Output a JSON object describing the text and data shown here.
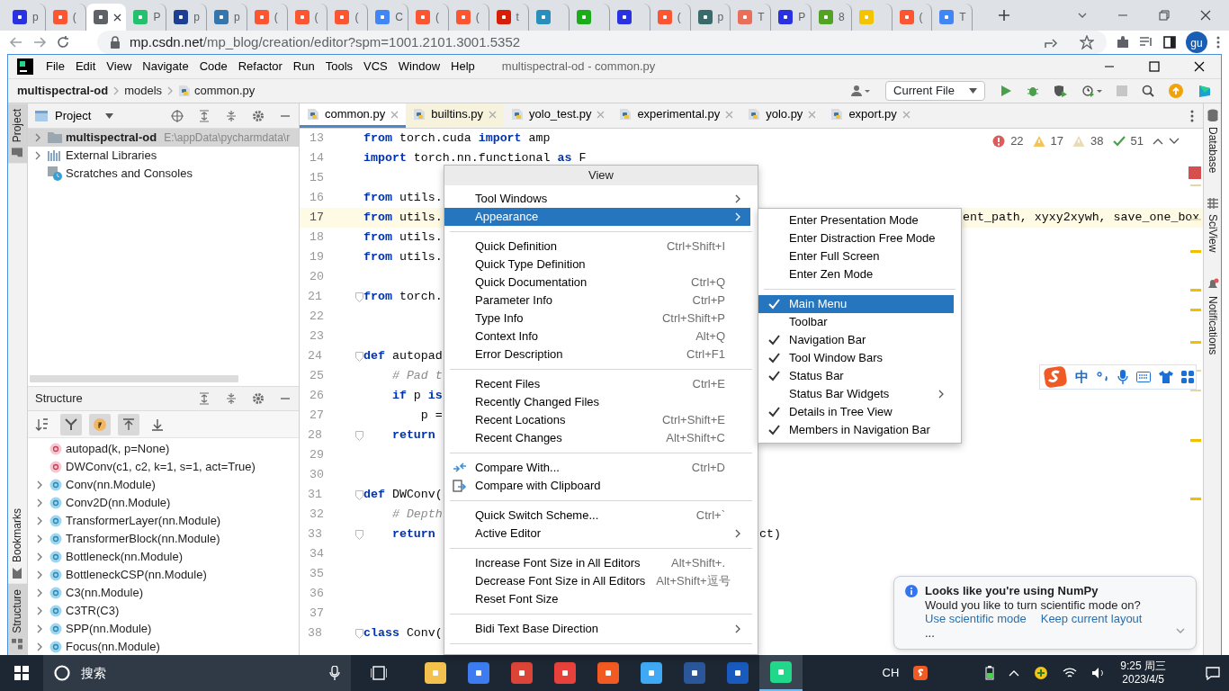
{
  "browser": {
    "tabs": [
      {
        "title": "p",
        "color": "#2932e1",
        "selected": false
      },
      {
        "title": "(",
        "color": "#fc5531",
        "selected": false
      },
      {
        "color": "#5f6368",
        "selected": true
      },
      {
        "title": "P",
        "color": "#23c16b",
        "selected": false
      },
      {
        "title": "p",
        "color": "#1c3f94",
        "selected": false
      },
      {
        "title": "p",
        "color": "#3776ab",
        "selected": false
      },
      {
        "title": "(",
        "color": "#fc5531",
        "selected": false
      },
      {
        "title": "(",
        "color": "#fc5531",
        "selected": false
      },
      {
        "title": "(",
        "color": "#fc5531",
        "selected": false
      },
      {
        "title": "C",
        "color": "#4285f4",
        "selected": false
      },
      {
        "title": "(",
        "color": "#fc5531",
        "selected": false
      },
      {
        "title": "(",
        "color": "#fc5531",
        "selected": false
      },
      {
        "title": "t",
        "color": "#d81e06",
        "selected": false
      },
      {
        "color": "#2a8fbd",
        "selected": false
      },
      {
        "color": "#1aad19",
        "selected": false
      },
      {
        "color": "#2932e1",
        "selected": false
      },
      {
        "title": "(",
        "color": "#fc5531",
        "selected": false
      },
      {
        "title": "p",
        "color": "#3a6b6b",
        "selected": false
      },
      {
        "title": "T",
        "color": "#ea6f5a",
        "selected": false
      },
      {
        "title": "P",
        "color": "#2932e1",
        "selected": false
      },
      {
        "title": "8",
        "color": "#52a224",
        "selected": false
      },
      {
        "color": "#f5c400",
        "selected": false
      },
      {
        "title": "(",
        "color": "#fc5531",
        "selected": false
      },
      {
        "title": "T",
        "color": "#4285f4",
        "selected": false
      }
    ],
    "url_host": "mp.csdn.net",
    "url_path": "/mp_blog/creation/editor?spm=1001.2101.3001.5352",
    "avatar": "gu"
  },
  "ide": {
    "menu": [
      "File",
      "Edit",
      "View",
      "Navigate",
      "Code",
      "Refactor",
      "Run",
      "Tools",
      "VCS",
      "Window",
      "Help"
    ],
    "title": "multispectral-od - common.py",
    "breadcrumb": [
      "multispectral-od",
      "models",
      "common.py"
    ],
    "run_config": "Current File",
    "left_stripe": [
      {
        "label": "Project",
        "selected": true
      },
      {
        "label": "Bookmarks",
        "selected": false
      },
      {
        "label": "Structure",
        "selected": true
      }
    ],
    "right_stripe": [
      "Database",
      "SciView",
      "Notifications"
    ],
    "project": {
      "title": "Project",
      "tree": [
        {
          "label": "multispectral-od",
          "path": "E:\\appData\\pycharmdata\\r",
          "kind": "folder",
          "expandable": true,
          "selected": true
        },
        {
          "label": "External Libraries",
          "kind": "library",
          "expandable": true,
          "selected": false
        },
        {
          "label": "Scratches and Consoles",
          "kind": "scratch",
          "expandable": false,
          "selected": false
        }
      ]
    },
    "structure": {
      "title": "Structure",
      "toolbar": [
        {
          "kind": "sort",
          "pressed": false
        },
        {
          "kind": "filter",
          "pressed": true
        },
        {
          "kind": "fields",
          "pressed": true
        },
        {
          "kind": "expand",
          "pressed": true
        },
        {
          "kind": "collapse",
          "pressed": false
        }
      ],
      "items": [
        {
          "label": "autopad(k, p=None)",
          "kind": "function",
          "expandable": false
        },
        {
          "label": "DWConv(c1, c2, k=1, s=1, act=True)",
          "kind": "function",
          "expandable": false
        },
        {
          "label": "Conv(nn.Module)",
          "kind": "class",
          "expandable": true
        },
        {
          "label": "Conv2D(nn.Module)",
          "kind": "class",
          "expandable": true
        },
        {
          "label": "TransformerLayer(nn.Module)",
          "kind": "class",
          "expandable": true
        },
        {
          "label": "TransformerBlock(nn.Module)",
          "kind": "class",
          "expandable": true
        },
        {
          "label": "Bottleneck(nn.Module)",
          "kind": "class",
          "expandable": true
        },
        {
          "label": "BottleneckCSP(nn.Module)",
          "kind": "class",
          "expandable": true
        },
        {
          "label": "C3(nn.Module)",
          "kind": "class",
          "expandable": true
        },
        {
          "label": "C3TR(C3)",
          "kind": "class",
          "expandable": true
        },
        {
          "label": "SPP(nn.Module)",
          "kind": "class",
          "expandable": true
        },
        {
          "label": "Focus(nn.Module)",
          "kind": "class",
          "expandable": true
        }
      ]
    },
    "tabs": [
      {
        "label": "common.py",
        "selected": true,
        "library": false
      },
      {
        "label": "builtins.py",
        "selected": false,
        "library": true
      },
      {
        "label": "yolo_test.py",
        "selected": false,
        "library": false
      },
      {
        "label": "experimental.py",
        "selected": false,
        "library": false
      },
      {
        "label": "yolo.py",
        "selected": false,
        "library": false
      },
      {
        "label": "export.py",
        "selected": false,
        "library": false
      }
    ],
    "inspections": [
      {
        "kind": "error",
        "count": "22"
      },
      {
        "kind": "warning",
        "count": "17"
      },
      {
        "kind": "weak",
        "count": "38"
      },
      {
        "kind": "typo",
        "count": "51"
      }
    ],
    "lines": [
      {
        "number": "13",
        "current": false,
        "fold": false,
        "tokens": [
          {
            "kind": "kw",
            "t": "from"
          },
          {
            "kind": "txt",
            "t": " torch.cuda "
          },
          {
            "kind": "kw",
            "t": "import"
          },
          {
            "kind": "txt",
            "t": " amp"
          }
        ]
      },
      {
        "number": "14",
        "current": false,
        "fold": false,
        "tokens": [
          {
            "kind": "kw",
            "t": "import"
          },
          {
            "kind": "txt",
            "t": " torch.nn.functional "
          },
          {
            "kind": "kw",
            "t": "as"
          },
          {
            "kind": "txt",
            "t": " F"
          }
        ]
      },
      {
        "number": "15",
        "current": false,
        "fold": false
      },
      {
        "number": "16",
        "current": false,
        "fold": false,
        "tokens": [
          {
            "kind": "kw",
            "t": "from"
          },
          {
            "kind": "txt",
            "t": " utils."
          }
        ]
      },
      {
        "number": "17",
        "current": true,
        "fold": false,
        "tokens": [
          {
            "kind": "kw",
            "t": "from"
          },
          {
            "kind": "txt",
            "t": " utils."
          }
        ],
        "tail": "ent_path, xyxy2xywh, save_one_box"
      },
      {
        "number": "18",
        "current": false,
        "fold": false,
        "tokens": [
          {
            "kind": "kw",
            "t": "from"
          },
          {
            "kind": "txt",
            "t": " utils."
          }
        ]
      },
      {
        "number": "19",
        "current": false,
        "fold": false,
        "tokens": [
          {
            "kind": "kw",
            "t": "from"
          },
          {
            "kind": "txt",
            "t": " utils."
          }
        ]
      },
      {
        "number": "20",
        "current": false,
        "fold": false
      },
      {
        "number": "21",
        "current": false,
        "fold": true,
        "tokens": [
          {
            "kind": "kw",
            "t": "from"
          },
          {
            "kind": "txt",
            "t": " torch."
          }
        ]
      },
      {
        "number": "22",
        "current": false,
        "fold": false
      },
      {
        "number": "23",
        "current": false,
        "fold": false
      },
      {
        "number": "24",
        "current": false,
        "fold": true,
        "tokens": [
          {
            "kind": "kw",
            "t": "def"
          },
          {
            "kind": "txt",
            "t": " autopad"
          }
        ]
      },
      {
        "number": "25",
        "current": false,
        "fold": false,
        "tokens": [
          {
            "kind": "cmt",
            "t": "    # Pad t"
          }
        ]
      },
      {
        "number": "26",
        "current": false,
        "fold": false,
        "tokens": [
          {
            "kind": "kw",
            "t": "    if"
          },
          {
            "kind": "txt",
            "t": " p "
          },
          {
            "kind": "kw",
            "t": "is"
          }
        ]
      },
      {
        "number": "27",
        "current": false,
        "fold": false,
        "tokens": [
          {
            "kind": "txt",
            "t": "        p ="
          }
        ]
      },
      {
        "number": "28",
        "current": false,
        "fold": true,
        "tokens": [
          {
            "kind": "kw",
            "t": "    return"
          }
        ]
      },
      {
        "number": "29",
        "current": false,
        "fold": false
      },
      {
        "number": "30",
        "current": false,
        "fold": false
      },
      {
        "number": "31",
        "current": false,
        "fold": true,
        "tokens": [
          {
            "kind": "kw",
            "t": "def"
          },
          {
            "kind": "txt",
            "t": " DWConv("
          }
        ]
      },
      {
        "number": "32",
        "current": false,
        "fold": false,
        "tokens": [
          {
            "kind": "cmt",
            "t": "    # Depth"
          }
        ]
      },
      {
        "number": "33",
        "current": false,
        "fold": true,
        "tokens": [
          {
            "kind": "kw",
            "t": "    return"
          }
        ],
        "tail": "ct)"
      },
      {
        "number": "34",
        "current": false,
        "fold": false
      },
      {
        "number": "35",
        "current": false,
        "fold": false
      },
      {
        "number": "36",
        "current": false,
        "fold": false
      },
      {
        "number": "37",
        "current": false,
        "fold": false
      },
      {
        "number": "38",
        "current": false,
        "fold": true,
        "tokens": [
          {
            "kind": "kw",
            "t": "class"
          },
          {
            "kind": "txt",
            "t": " Conv("
          }
        ]
      }
    ],
    "view_menu": {
      "title": "View",
      "items": [
        {
          "kind": "item",
          "label": "Tool Windows",
          "submenu": true,
          "selected": false
        },
        {
          "kind": "item",
          "label": "Appearance",
          "submenu": true,
          "selected": true
        },
        {
          "kind": "separator"
        },
        {
          "kind": "item",
          "label": "Quick Definition",
          "shortcut": "Ctrl+Shift+I",
          "submenu": false,
          "selected": false
        },
        {
          "kind": "item",
          "label": "Quick Type Definition",
          "submenu": false,
          "selected": false
        },
        {
          "kind": "item",
          "label": "Quick Documentation",
          "shortcut": "Ctrl+Q",
          "submenu": false,
          "selected": false
        },
        {
          "kind": "item",
          "label": "Parameter Info",
          "shortcut": "Ctrl+P",
          "submenu": false,
          "selected": false
        },
        {
          "kind": "item",
          "label": "Type Info",
          "shortcut": "Ctrl+Shift+P",
          "submenu": false,
          "selected": false
        },
        {
          "kind": "item",
          "label": "Context Info",
          "shortcut": "Alt+Q",
          "submenu": false,
          "selected": false
        },
        {
          "kind": "item",
          "label": "Error Description",
          "shortcut": "Ctrl+F1",
          "submenu": false,
          "selected": false
        },
        {
          "kind": "separator"
        },
        {
          "kind": "item",
          "label": "Recent Files",
          "shortcut": "Ctrl+E",
          "submenu": false,
          "selected": false
        },
        {
          "kind": "item",
          "label": "Recently Changed Files",
          "submenu": false,
          "selected": false
        },
        {
          "kind": "item",
          "label": "Recent Locations",
          "shortcut": "Ctrl+Shift+E",
          "submenu": false,
          "selected": false
        },
        {
          "kind": "item",
          "label": "Recent Changes",
          "shortcut": "Alt+Shift+C",
          "submenu": false,
          "selected": false
        },
        {
          "kind": "separator"
        },
        {
          "kind": "diff",
          "label": "Compare With...",
          "shortcut": "Ctrl+D",
          "submenu": false,
          "selected": false
        },
        {
          "kind": "clipboard",
          "label": "Compare with Clipboard",
          "submenu": false,
          "selected": false
        },
        {
          "kind": "separator"
        },
        {
          "kind": "item",
          "label": "Quick Switch Scheme...",
          "shortcut": "Ctrl+`",
          "submenu": false,
          "selected": false
        },
        {
          "kind": "item",
          "label": "Active Editor",
          "submenu": true,
          "selected": false
        },
        {
          "kind": "separator"
        },
        {
          "kind": "item",
          "label": "Increase Font Size in All Editors",
          "shortcut": "Alt+Shift+.",
          "submenu": false,
          "selected": false
        },
        {
          "kind": "item",
          "label": "Decrease Font Size in All Editors",
          "shortcut": "Alt+Shift+逗号",
          "submenu": false,
          "selected": false
        },
        {
          "kind": "item",
          "label": "Reset Font Size",
          "submenu": false,
          "selected": false
        },
        {
          "kind": "separator"
        },
        {
          "kind": "item",
          "label": "Bidi Text Base Direction",
          "submenu": true,
          "selected": false
        },
        {
          "kind": "separator"
        }
      ]
    },
    "appearance_menu": [
      {
        "kind": "item",
        "label": "Enter Presentation Mode",
        "checked": false,
        "submenu": false,
        "selected": false
      },
      {
        "kind": "item",
        "label": "Enter Distraction Free Mode",
        "checked": false,
        "submenu": false,
        "selected": false
      },
      {
        "kind": "item",
        "label": "Enter Full Screen",
        "checked": false,
        "submenu": false,
        "selected": false
      },
      {
        "kind": "item",
        "label": "Enter Zen Mode",
        "checked": false,
        "submenu": false,
        "selected": false
      },
      {
        "kind": "separator"
      },
      {
        "kind": "item",
        "label": "Main Menu",
        "checked": true,
        "submenu": false,
        "selected": true
      },
      {
        "kind": "item",
        "label": "Toolbar",
        "checked": false,
        "submenu": false,
        "selected": false
      },
      {
        "kind": "item",
        "label": "Navigation Bar",
        "checked": true,
        "submenu": false,
        "selected": false
      },
      {
        "kind": "item",
        "label": "Tool Window Bars",
        "checked": true,
        "submenu": false,
        "selected": false
      },
      {
        "kind": "item",
        "label": "Status Bar",
        "checked": true,
        "submenu": false,
        "selected": false
      },
      {
        "kind": "item",
        "label": "Status Bar Widgets",
        "checked": false,
        "submenu": true,
        "selected": false
      },
      {
        "kind": "item",
        "label": "Details in Tree View",
        "checked": true,
        "submenu": false,
        "selected": false
      },
      {
        "kind": "item",
        "label": "Members in Navigation Bar",
        "checked": true,
        "submenu": false,
        "selected": false
      }
    ],
    "notification": {
      "title": "Looks like you're using NumPy",
      "body": "Would you like to turn scientific mode on?",
      "actions": [
        "Use scientific mode",
        "Keep current layout"
      ],
      "more": "..."
    }
  },
  "ime": {
    "mode": "中"
  },
  "taskbar": {
    "search": "搜索",
    "apps": [
      {
        "color": "#f4c04e",
        "selected": false
      },
      {
        "color": "#3c7cf0",
        "selected": false
      },
      {
        "color": "#db4437",
        "selected": false
      },
      {
        "color": "#e8413b",
        "selected": false
      },
      {
        "color": "#f25a22",
        "selected": false
      },
      {
        "color": "#3fa9f5",
        "selected": false
      },
      {
        "color": "#2b579a",
        "selected": false
      },
      {
        "color": "#185abd",
        "selected": false
      },
      {
        "color": "#21d789",
        "selected": true
      }
    ],
    "input_lang": "CH",
    "time": "9:25 周三",
    "date": "2023/4/5"
  }
}
